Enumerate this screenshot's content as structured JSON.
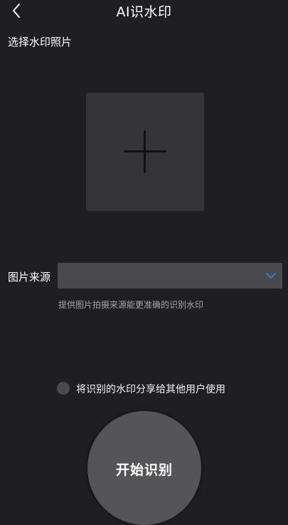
{
  "header": {
    "title": "AI识水印",
    "back_icon": "chevron-left-icon"
  },
  "upload": {
    "label": "选择水印照片",
    "icon": "plus-icon"
  },
  "source": {
    "label": "图片来源",
    "selected_value": "",
    "hint": "提供图片拍摄来源能更准确的识别水印",
    "accent_color": "#3f76d6"
  },
  "share": {
    "label": "将识别的水印分享给其他用户使用",
    "checked": false
  },
  "start_button": {
    "label": "开始识别"
  }
}
